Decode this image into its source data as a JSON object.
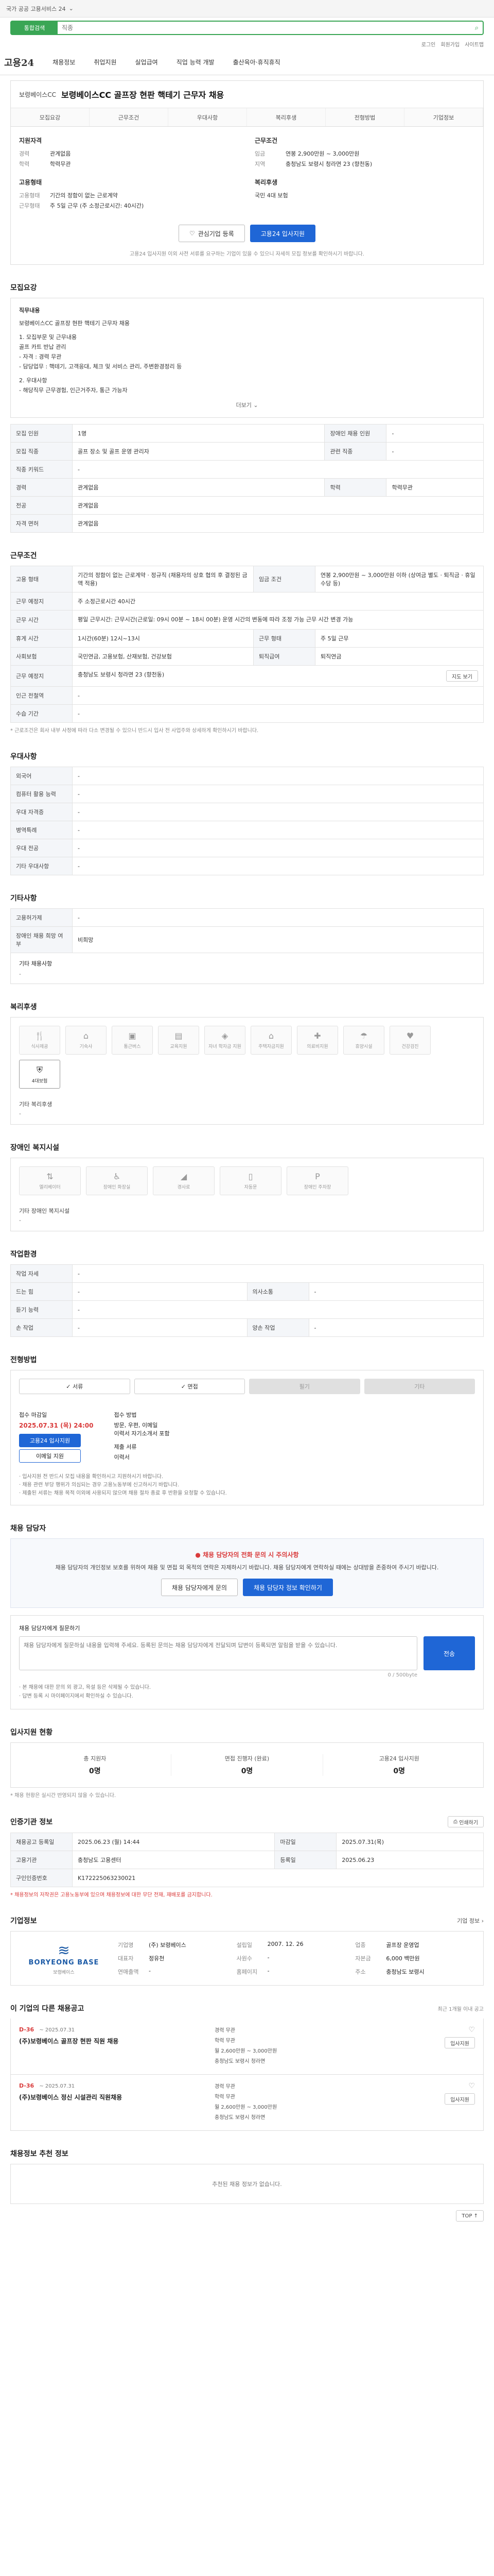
{
  "topbar": {
    "notice": "국가 공공 고용서비스 24",
    "chevron": "⌄"
  },
  "search": {
    "scope": "통합검색",
    "placeholder": "직종"
  },
  "util": {
    "login": "로그인",
    "join": "회원가입",
    "site": "사이트맵"
  },
  "gnb": {
    "logo": "고용24",
    "menus": [
      "채용정보",
      "취업지원",
      "실업급여",
      "직업 능력 개발",
      "출산육아·휴직휴직"
    ]
  },
  "job": {
    "company": "보령베이스CC",
    "title": "보령베이스CC 골프장 현판 핵테기 근무자 채용",
    "tabs": [
      "모집요강",
      "근무조건",
      "우대사항",
      "복리후생",
      "전형방법",
      "기업정보"
    ],
    "qual_head": "지원자격",
    "qualifications": [
      {
        "k": "경력",
        "v": "관계없음"
      },
      {
        "k": "학력",
        "v": "학력무관"
      }
    ],
    "cond_head": "근무조건",
    "conditions": [
      {
        "k": "임금",
        "v": "연봉 2,900만원 ~ 3,000만원"
      },
      {
        "k": "지역",
        "v": "충청남도 보령시 청라면 23 (향천동)"
      }
    ],
    "emp_head": "고용형태",
    "employment": [
      {
        "k": "고용형태",
        "v": "기간의 정함이 없는 근로계약"
      },
      {
        "k": "근무형태",
        "v": "주 5일 근무 (주 소정근로시간: 40시간)"
      }
    ],
    "welfare_head": "복리후생",
    "welfare_summary": "국민 4대 보험"
  },
  "actions": {
    "save": "관심기업 등록",
    "apply": "고용24 입사지원"
  },
  "notice_line": "고용24 입사지원 이외 사전 서류를 요구하는 기업이 있을 수 있으니 자세히 모집 정보를 확인하시기 바랍니다.",
  "recruit": {
    "heading": "모집요강",
    "desc_title": "직무내용",
    "desc_lines": [
      "보령베이스CC 골프장 현판 핵테기 근무자 채용",
      "1. 모집부문 및 근무내용",
      "  골프 카트 반납 관리",
      "  - 자격 : 경력 무관",
      "  - 담당업무 : 핵테기, 고객응대, 체크 및 서비스 관리, 주변환경정리 등",
      "2. 우대사항",
      "  - 해당직무 근무경험, 인근거주자, 통근 가능자"
    ],
    "more": "더보기",
    "table": [
      [
        "모집 인원",
        "1명",
        "장애인 채용 인원",
        "-"
      ],
      [
        "모집 직종",
        "골프 장소 및 골프 운영 관리자",
        "관련 직종",
        "-"
      ],
      [
        "직종 키워드",
        "-",
        "",
        ""
      ],
      [
        "경력",
        "관계없음",
        "학력",
        "학력무관"
      ],
      [
        "전공",
        "관계없음",
        "",
        ""
      ],
      [
        "자격 면허",
        "관계없음",
        "",
        ""
      ]
    ]
  },
  "workcond": {
    "heading": "근무조건",
    "rows": [
      [
        "고용 형태",
        "기간의 정함이 없는 근로계약 · 정규직 (채용자의 상호 협의 후 결정된 금액 적용)",
        "임금 조건",
        "연봉 2,900만원 ~ 3,000만원 이하 (상여금 별도 · 퇴직금 · 휴일수당 등)"
      ],
      [
        "근무 예정지",
        "주 소정근로시간 40시간",
        "",
        ""
      ],
      [
        "근무 시간",
        "평일 근무시간: 근무시간(근로일: 09시 00분 ~ 18시 00분) 운영 시간의 변동에 따라 조정 가능 근무 시간 변경 가능",
        "",
        ""
      ],
      [
        "휴게 시간",
        "1시간(60분) 12시~13시",
        "근무 형태",
        "주 5일 근무"
      ],
      [
        "사회보험",
        "국민연금, 고용보험, 산재보험, 건강보험",
        "퇴직급여",
        "퇴직연금"
      ],
      [
        "근무 예정지",
        "충청남도 보령시 청라면 23 (향천동)",
        "",
        ""
      ],
      [
        "인근 전철역",
        "-",
        "",
        ""
      ],
      [
        "수습 기간",
        "-",
        "",
        ""
      ]
    ],
    "map_btn": "지도 보기",
    "note": "* 근로조건은 회사 내부 사정에 따라 다소 변경될 수 있으니 반드시 입사 전 사업주와 상세하게 확인하시기 바랍니다."
  },
  "pref": {
    "heading": "우대사항",
    "rows": [
      [
        "외국어",
        "-"
      ],
      [
        "컴퓨터 활용 능력",
        "-"
      ],
      [
        "우대 자격증",
        "-"
      ],
      [
        "병역특례",
        "-"
      ],
      [
        "우대 전공",
        "-"
      ],
      [
        "기타 우대사항",
        "-"
      ]
    ]
  },
  "other": {
    "heading": "기타사항",
    "rows": [
      [
        "고용허가제",
        "-"
      ],
      [
        "장애인 채용 희망 여부",
        "비희망"
      ]
    ],
    "extra_title": "기타 채용사항",
    "extra_val": "-"
  },
  "welfare": {
    "heading": "복리후생",
    "items": [
      "식사제공",
      "기숙사",
      "통근버스",
      "교육지원",
      "자녀 학자금 지원",
      "주택자금지원",
      "의료비지원",
      "휴양시설",
      "건강검진",
      "4대보험"
    ],
    "active_index": 9,
    "caption_title": "기타 복리후생",
    "caption_val": "-"
  },
  "disability": {
    "heading": "장애인 복지시설",
    "items": [
      "엘리베이터",
      "장애인 화장실",
      "경사로",
      "자동문",
      "장애인 주차장"
    ],
    "caption_title": "기타 장애인 복지시설",
    "caption_val": "-"
  },
  "workenv": {
    "heading": "작업환경",
    "rows": [
      [
        "작업 자세",
        "-",
        "",
        ""
      ],
      [
        "드는 힘",
        "-",
        "의사소통",
        "-"
      ],
      [
        "듣기 능력",
        "-",
        "",
        ""
      ],
      [
        "손 작업",
        "-",
        "양손 작업",
        "-"
      ]
    ]
  },
  "selection": {
    "heading": "전형방법",
    "steps": [
      "서류",
      "면접",
      "필기",
      "기타"
    ],
    "apply_period_label": "접수 마감일",
    "apply_deadline": "2025.07.31 (목) 24:00",
    "apply_btn": "고용24 입사지원",
    "email_btn": "이메일 지원",
    "method_label": "접수 방법",
    "methods": [
      "방문, 우편, 이메일",
      "이력서 자기소개서 포함"
    ],
    "docs_label": "제출 서류",
    "docs_val": "이력서",
    "notes": [
      "· 입사지원 전 반드시 모집 내용을 확인하시고 지원하시기 바랍니다.",
      "· 채용 관련 부당 행위가 의심되는 경우 고용노동부에 신고하시기 바랍니다.",
      "· 제출된 서류는 채용 목적 이외에 사용되지 않으며 채용 절차 종료 후 반환을 요청할 수 있습니다."
    ]
  },
  "safety": {
    "heading": "채용 담당자",
    "title": "● 채용 담당자의 전화 문의 시 주의사항",
    "body": "채용 담당자의 개인정보 보호를 위하여 채용 및 면접 외 목적의 연락은 자제하시기 바랍니다. 채용 담당자에게 연락하실 때에는 상대방을 존중하여 주시기 바랍니다.",
    "btn1": "채용 담당자에게 문의",
    "btn2": "채용 담당자 정보 확인하기"
  },
  "inquiry": {
    "label": "채용 담당자에게 질문하기",
    "placeholder": "채용 담당자에게 질문하실 내용을 입력해 주세요. 등록된 문의는 채용 담당자에게 전달되며 답변이 등록되면 알림을 받을 수 있습니다.",
    "counter": "0 / 500byte",
    "submit": "전송",
    "notes": [
      "· 본 채용에 대한 문의 외 광고, 욕설 등은 삭제될 수 있습니다.",
      "· 답변 등록 시 마이페이지에서 확인하실 수 있습니다."
    ]
  },
  "status": {
    "heading": "입사지원 현황",
    "items": [
      {
        "label": "총 지원자",
        "val": "0명"
      },
      {
        "label": "면접 진행자 (완료)",
        "val": "0명"
      },
      {
        "label": "고용24 입사지원",
        "val": "0명"
      }
    ],
    "note": "* 채용 현황은 실시간 반영되지 않을 수 있습니다."
  },
  "info": {
    "heading": "인증기관 정보",
    "print": "인쇄하기",
    "rows": [
      [
        "채용공고 등록일",
        "2025.06.23 (월) 14:44",
        "마감일",
        "2025.07.31(목)"
      ],
      [
        "고용기관",
        "충청남도 고용센터",
        "등록일",
        "2025.06.23"
      ],
      [
        "구인인증번호",
        "K172225063230021",
        "",
        ""
      ]
    ],
    "note": "* 채용정보의 저작권은 고용노동부에 있으며 채용정보에 대한 무단 전재, 재배포를 금지합니다."
  },
  "company": {
    "heading": "기업정보",
    "more": "기업 정보 ›",
    "logo_name": "BORYEONG BASE",
    "logo_cap": "보령베이스",
    "fields": [
      [
        "기업명",
        "(주) 보령베이스",
        "설립일",
        "2007. 12. 26",
        "업종",
        "골프장 운영업"
      ],
      [
        "대표자",
        "정유천",
        "사원수",
        "-",
        "자본금",
        "6,000 백만원"
      ],
      [
        "연매출액",
        "-",
        "홈페이지",
        "-",
        "주소",
        "충청남도 보령시"
      ]
    ]
  },
  "others": {
    "heading": "이 기업의 다른 채용공고",
    "sub": "최근 1개월 이내 공고",
    "list": [
      {
        "dday": "D-36",
        "date": "~ 2025.07.31",
        "title": "(주)보령베이스 골프장 현판 직원 채용",
        "tags": [
          "경력 무관",
          "학력 무관",
          "월 2,600만원 ~ 3,000만원",
          "충청남도 보령시 청라면"
        ],
        "action": "입사지원"
      },
      {
        "dday": "D-36",
        "date": "~ 2025.07.31",
        "title": "(주)보령베이스 정신 시설관리 직원채용",
        "tags": [
          "경력 무관",
          "학력 무관",
          "월 2,600만원 ~ 3,000만원",
          "충청남도 보령시 청라면"
        ],
        "action": "입사지원"
      }
    ]
  },
  "recommend": {
    "heading": "채용정보 추천 정보",
    "empty": "추천된 채용 정보가 없습니다."
  },
  "topbtn": "TOP ↑"
}
